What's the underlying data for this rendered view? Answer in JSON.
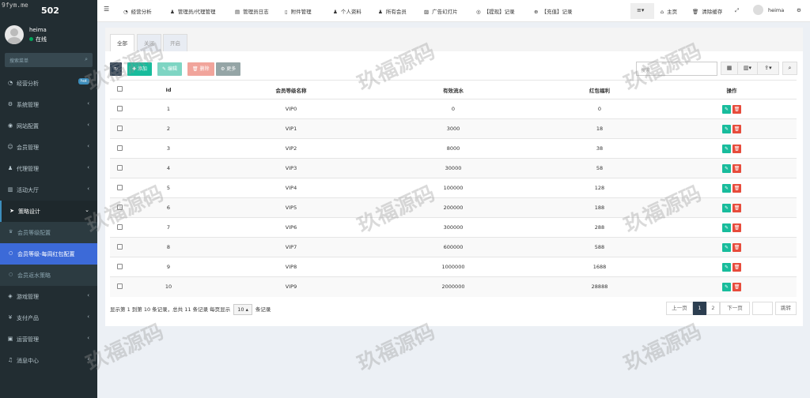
{
  "brand": {
    "watermark_url": "9fym.me",
    "title": "502"
  },
  "user": {
    "name": "heima",
    "status": "在线"
  },
  "search": {
    "placeholder": "搜索菜单",
    "icon": "search-icon"
  },
  "menu": [
    {
      "label": "经营分析",
      "icon": "dashboard-icon",
      "badge": "hot"
    },
    {
      "label": "系统管理",
      "icon": "gears-icon"
    },
    {
      "label": "网站配置",
      "icon": "globe-icon"
    },
    {
      "label": "会员管理",
      "icon": "user-circle-icon"
    },
    {
      "label": "代理管理",
      "icon": "user-icon"
    },
    {
      "label": "活动大厅",
      "icon": "building-icon"
    },
    {
      "label": "策略设计",
      "icon": "send-icon"
    }
  ],
  "submenu": [
    {
      "label": "会员等级配置",
      "icon": "trophy-icon"
    },
    {
      "label": "会员等级-每周红包配置",
      "icon": "circle-icon"
    },
    {
      "label": "会员返水策略",
      "icon": "circle-icon"
    }
  ],
  "menu2": [
    {
      "label": "游戏管理",
      "icon": "gamepad-icon"
    },
    {
      "label": "支付产品",
      "icon": "yen-icon"
    },
    {
      "label": "运营管理",
      "icon": "briefcase-icon"
    },
    {
      "label": "消息中心",
      "icon": "bell-icon"
    }
  ],
  "header": {
    "nav": [
      "经营分析",
      "管理员/代理管理",
      "管理员日志",
      "附件管理",
      "个人资料",
      "所有会员",
      "广告幻灯片",
      "【提现】记录",
      "【充值】记录"
    ],
    "home": "主页",
    "clear": "清除缓存",
    "user": "heima"
  },
  "tabs": [
    "全部",
    "关闭",
    "开启"
  ],
  "toolbar": {
    "add": "添加",
    "edit": "编辑",
    "del": "删除",
    "more": "更多",
    "search_placeholder": "搜索"
  },
  "table": {
    "headers": [
      "Id",
      "会员等级名称",
      "有效流水",
      "红包福利",
      "操作"
    ],
    "rows": [
      [
        "1",
        "VIP0",
        "0",
        "0"
      ],
      [
        "2",
        "VIP1",
        "3000",
        "18"
      ],
      [
        "3",
        "VIP2",
        "8000",
        "38"
      ],
      [
        "4",
        "VIP3",
        "30000",
        "58"
      ],
      [
        "5",
        "VIP4",
        "100000",
        "128"
      ],
      [
        "6",
        "VIP5",
        "200000",
        "188"
      ],
      [
        "7",
        "VIP6",
        "300000",
        "288"
      ],
      [
        "8",
        "VIP7",
        "600000",
        "588"
      ],
      [
        "9",
        "VIP8",
        "1000000",
        "1688"
      ],
      [
        "10",
        "VIP9",
        "2000000",
        "28888"
      ]
    ]
  },
  "footer": {
    "info_pre": "显示第 1 到第 10 条记录，总共 11 条记录 每页显示",
    "page_size": "10",
    "info_post": "条记录"
  },
  "pagination": {
    "prev": "上一页",
    "p1": "1",
    "p2": "2",
    "next": "下一页",
    "jump": "跳转"
  },
  "watermark": "玖福源码",
  "colors": {
    "sidebar": "#222d32",
    "active": "#3c6ad8",
    "green": "#18bc9c",
    "red": "#e74c3c",
    "orange": "#f39c12",
    "gray": "#95a5a6",
    "dark": "#2c3e50",
    "page_active": "#2c3e50"
  }
}
